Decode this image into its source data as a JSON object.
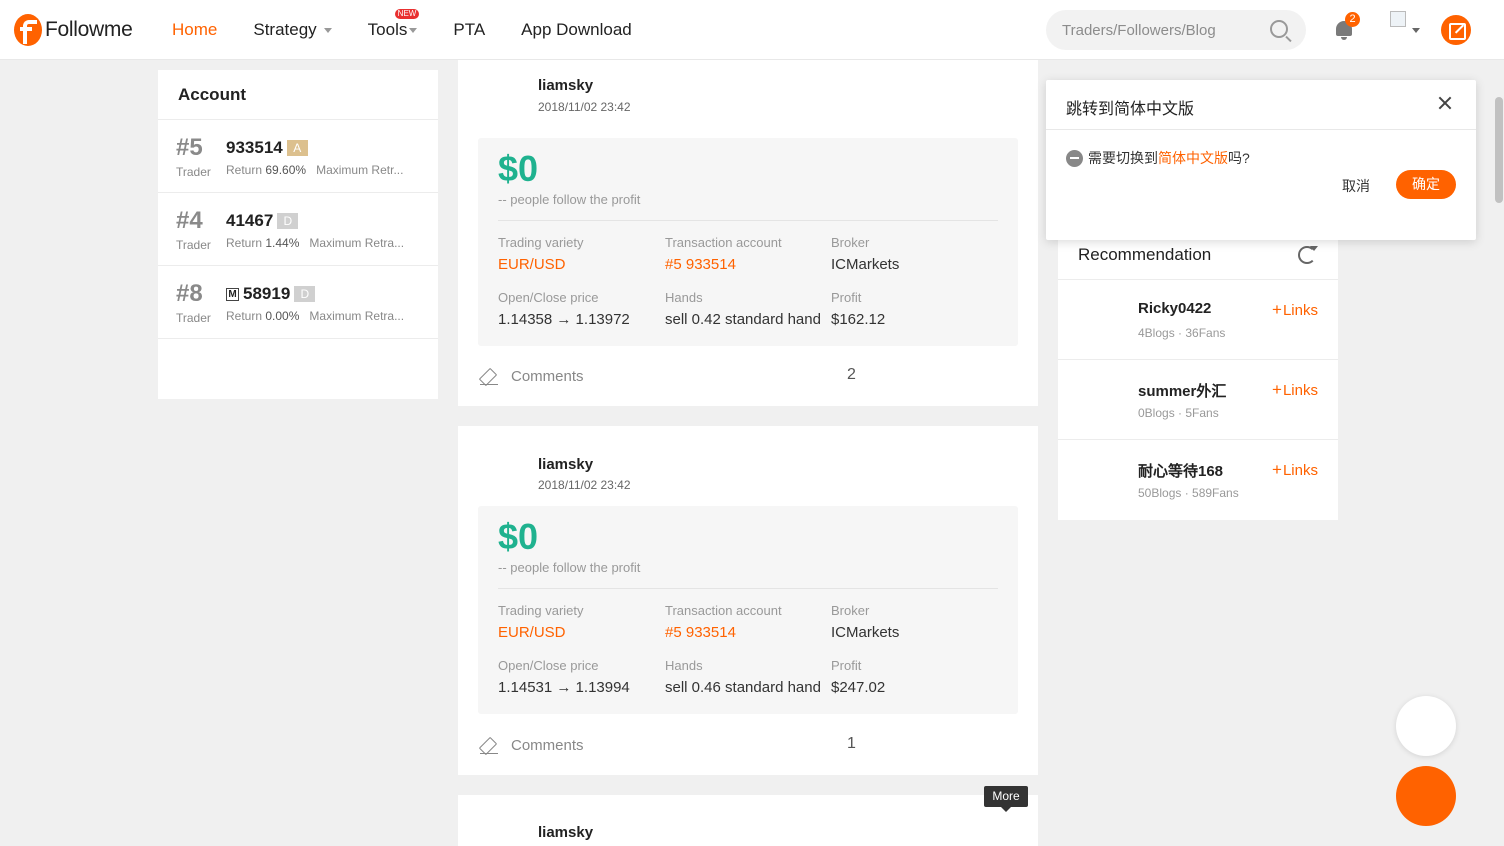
{
  "nav": {
    "logo_text": "Followme",
    "items": [
      {
        "label": "Home",
        "active": true
      },
      {
        "label": "Strategy",
        "dropdown": true
      },
      {
        "label": "Tools",
        "dropdown": true,
        "badge": "NEW"
      },
      {
        "label": "PTA"
      },
      {
        "label": "App Download"
      }
    ],
    "search_placeholder": "Traders/Followers/Blog",
    "notification_count": "2",
    "icons": [
      "search-icon",
      "bell-icon",
      "avatar-icon",
      "write-icon"
    ]
  },
  "account": {
    "title": "Account",
    "rows": [
      {
        "rank": "#5",
        "number": "933514",
        "grade": "A",
        "role": "Trader",
        "return_label": "Return",
        "return_value": "69.60%",
        "extra": "Maximum Retr..."
      },
      {
        "rank": "#4",
        "number": "41467",
        "grade": "D",
        "role": "Trader",
        "return_label": "Return",
        "return_value": "1.44%",
        "extra": "Maximum Retra..."
      },
      {
        "rank": "#8",
        "number": "58919",
        "grade": "D",
        "m_badge": "M",
        "role": "Trader",
        "return_label": "Return",
        "return_value": "0.00%",
        "extra": "Maximum Retra..."
      }
    ]
  },
  "posts": [
    {
      "author": "liamsky",
      "date": "2018/11/02 23:42",
      "profit": "$0",
      "follow_text": "-- people follow the profit",
      "labels": {
        "variety": "Trading variety",
        "account": "Transaction account",
        "broker": "Broker",
        "price": "Open/Close price",
        "hands": "Hands",
        "profit": "Profit"
      },
      "variety": "EUR/USD",
      "account": "#5 933514",
      "broker": "ICMarkets",
      "price": "1.14358 → 1.13972",
      "hands": "sell 0.42 standard hand",
      "profit_value": "$162.12",
      "comments_label": "Comments",
      "comment_count": "2"
    },
    {
      "author": "liamsky",
      "date": "2018/11/02 23:42",
      "profit": "$0",
      "follow_text": "-- people follow the profit",
      "labels": {
        "variety": "Trading variety",
        "account": "Transaction account",
        "broker": "Broker",
        "price": "Open/Close price",
        "hands": "Hands",
        "profit": "Profit"
      },
      "variety": "EUR/USD",
      "account": "#5 933514",
      "broker": "ICMarkets",
      "price": "1.14531 → 1.13994",
      "hands": "sell 0.46 standard hand",
      "profit_value": "$247.02",
      "comments_label": "Comments",
      "comment_count": "1"
    },
    {
      "author": "liamsky"
    }
  ],
  "recommendation": {
    "title": "Recommendation",
    "items": [
      {
        "name": "Ricky0422",
        "meta": "4Blogs · 36Fans",
        "link": "Links"
      },
      {
        "name": "summer外汇",
        "meta": "0Blogs · 5Fans",
        "link": "Links"
      },
      {
        "name": "耐心等待168",
        "meta": "50Blogs · 589Fans",
        "link": "Links"
      }
    ]
  },
  "popup": {
    "title": "跳转到简体中文版",
    "msg_before": "需要切换到",
    "msg_highlight": "简体中文版",
    "msg_after": "吗?",
    "cancel": "取消",
    "ok": "确定"
  },
  "tooltip": "More",
  "colors": {
    "accent": "#ff6200",
    "profit_green": "#1fb28f",
    "grade_a": "#dcc08e",
    "grade_d": "#d0d0d0"
  }
}
